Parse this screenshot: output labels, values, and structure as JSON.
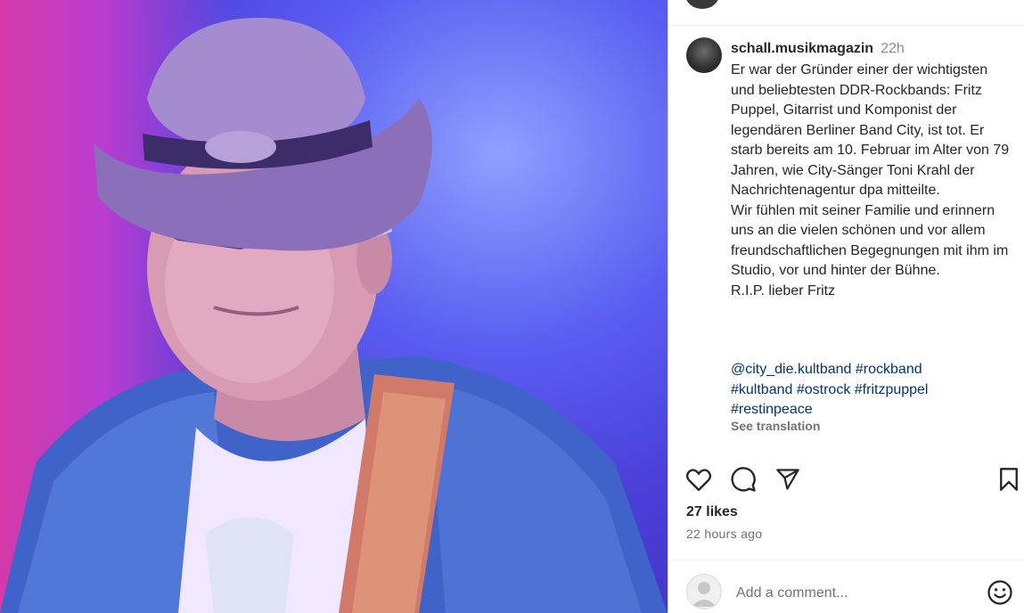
{
  "post": {
    "username": "schall.musikmagazin",
    "time": "22h",
    "caption": "Er war der Gründer einer der wichtigsten und beliebtesten DDR-Rockbands: Fritz Puppel, Gitarrist und Komponist der legendären Berliner Band City, ist tot. Er starb bereits am 10. Februar im Alter von 79 Jahren, wie City-Sänger Toni Krahl der Nachrichtenagentur dpa mitteilte.\nWir fühlen mit seiner Familie und erinnern uns an die vielen schönen und vor allem freundschaftlichen Begegnungen mit ihm im Studio, vor und hinter der Bühne.\nR.I.P. lieber Fritz",
    "tags": [
      "@city_die.kultband",
      "#rockband",
      "#kultband",
      "#ostrock",
      "#fritzpuppel",
      "#restinpeace"
    ],
    "see_translation": "See translation",
    "likes": "27 likes",
    "posted_ago": "22 hours ago"
  },
  "actions": {
    "like_icon": "heart-icon",
    "comment_icon": "comment-icon",
    "share_icon": "send-icon",
    "save_icon": "bookmark-icon"
  },
  "comment_box": {
    "placeholder": "Add a comment...",
    "emoji_icon": "smiley-icon"
  },
  "image": {
    "description_icon": "photo",
    "accent": "#4a3fd8"
  }
}
